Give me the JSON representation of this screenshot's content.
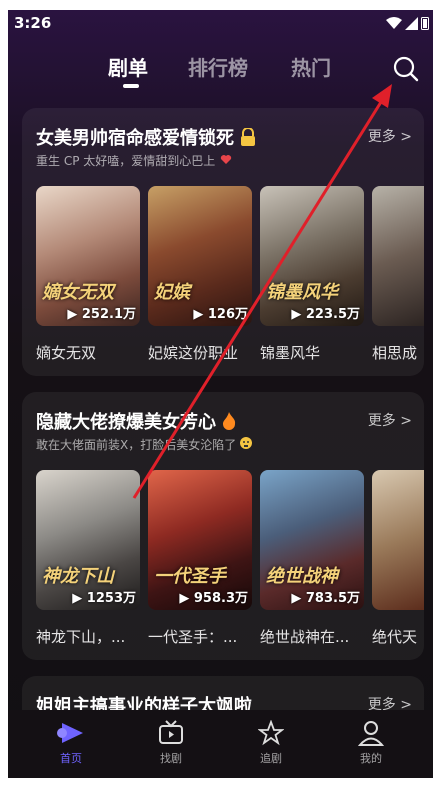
{
  "status": {
    "time": "3:26"
  },
  "tabs": [
    "剧单",
    "排行榜",
    "热门"
  ],
  "sections": [
    {
      "title": "女美男帅宿命感爱情锁死",
      "subtitle": "重生 CP 太好嗑，爱情甜到心巴上",
      "more": "更多 >",
      "items": [
        {
          "title": "嫡女无双",
          "views": "▶ 252.1万",
          "logo": "嫡女无双"
        },
        {
          "title": "妃嫔这份职业",
          "views": "▶ 126万",
          "logo": "妃嫔"
        },
        {
          "title": "锦墨风华",
          "views": "▶ 223.5万",
          "logo": "锦墨风华"
        },
        {
          "title": "相思成",
          "views": "",
          "logo": ""
        }
      ]
    },
    {
      "title": "隐藏大佬撩爆美女芳心",
      "subtitle": "敢在大佬面前装X，打脸后美女沦陷了",
      "more": "更多 >",
      "items": [
        {
          "title": "神龙下山，...",
          "views": "▶ 1253万",
          "logo": "神龙下山"
        },
        {
          "title": "一代圣手：...",
          "views": "▶ 958.3万",
          "logo": "一代圣手"
        },
        {
          "title": "绝世战神在...",
          "views": "▶ 783.5万",
          "logo": "绝世战神"
        },
        {
          "title": "绝代天",
          "views": "",
          "logo": ""
        }
      ]
    },
    {
      "title": "姐姐主搞事业的样子太飒啦",
      "more": "更多 >"
    }
  ],
  "nav": [
    {
      "label": "首页",
      "icon": "home-icon",
      "active": true
    },
    {
      "label": "找剧",
      "icon": "tv-icon"
    },
    {
      "label": "追剧",
      "icon": "star-icon"
    },
    {
      "label": "我的",
      "icon": "user-icon"
    }
  ],
  "colors": {
    "accent": "#6f63ff",
    "annotation": "#e0202a"
  }
}
